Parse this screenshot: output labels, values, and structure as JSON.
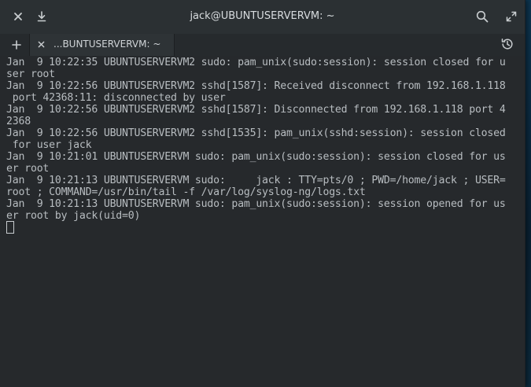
{
  "window": {
    "title": "jack@UBUNTUSERVERVM: ~"
  },
  "titlebar": {
    "close_icon": "close-icon",
    "download_icon": "download-icon",
    "search_icon": "search-icon",
    "maximize_icon": "maximize-icon"
  },
  "tabs": [
    {
      "label": "...BUNTUSERVERVM: ~"
    }
  ],
  "terminal": {
    "lines": [
      "Jan  9 10:22:35 UBUNTUSERVERVM2 sudo: pam_unix(sudo:session): session closed for u",
      "ser root",
      "Jan  9 10:22:56 UBUNTUSERVERVM2 sshd[1587]: Received disconnect from 192.168.1.118",
      " port 42368:11: disconnected by user",
      "Jan  9 10:22:56 UBUNTUSERVERVM2 sshd[1587]: Disconnected from 192.168.1.118 port 4",
      "2368",
      "Jan  9 10:22:56 UBUNTUSERVERVM2 sshd[1535]: pam_unix(sshd:session): session closed",
      " for user jack",
      "Jan  9 10:21:01 UBUNTUSERVERVM sudo: pam_unix(sudo:session): session closed for us",
      "er root",
      "Jan  9 10:21:13 UBUNTUSERVERVM sudo:     jack : TTY=pts/0 ; PWD=/home/jack ; USER=",
      "root ; COMMAND=/usr/bin/tail -f /var/log/syslog-ng/logs.txt",
      "Jan  9 10:21:13 UBUNTUSERVERVM sudo: pam_unix(sudo:session): session opened for us",
      "er root by jack(uid=0)"
    ]
  }
}
